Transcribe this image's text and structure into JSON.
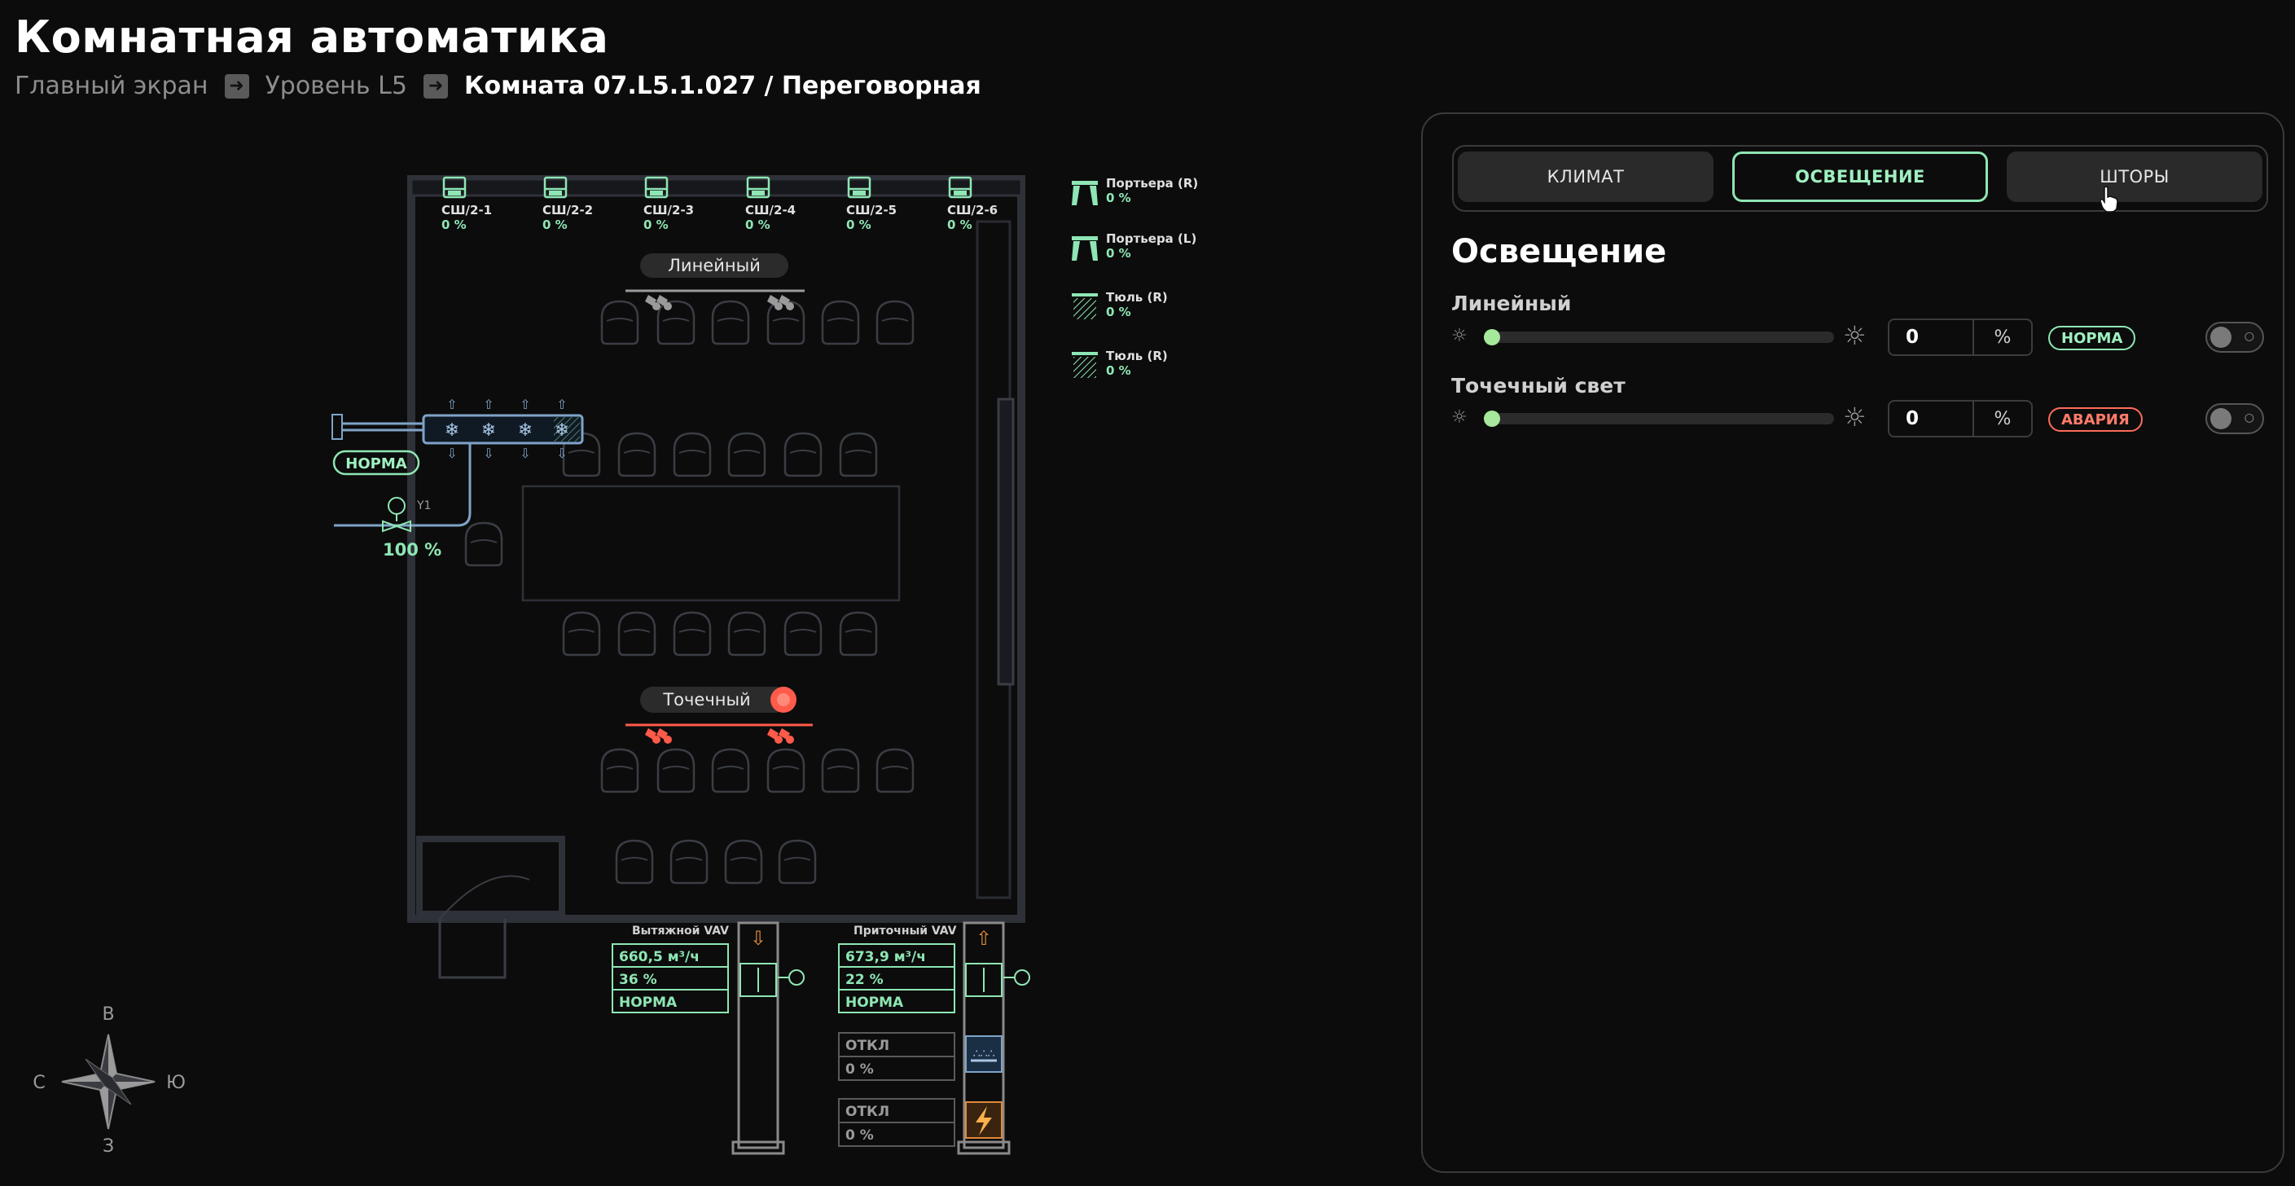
{
  "header": {
    "title": "Комнатная автоматика",
    "breadcrumbs": [
      "Главный экран",
      "Уровень L5",
      "Комната 07.L5.1.027 / Переговорная"
    ],
    "arrow_glyph": "➜"
  },
  "plan": {
    "windows": [
      {
        "name": "СШ/2-1",
        "value": "0 %"
      },
      {
        "name": "СШ/2-2",
        "value": "0 %"
      },
      {
        "name": "СШ/2-3",
        "value": "0 %"
      },
      {
        "name": "СШ/2-4",
        "value": "0 %"
      },
      {
        "name": "СШ/2-5",
        "value": "0 %"
      },
      {
        "name": "СШ/2-6",
        "value": "0 %"
      }
    ],
    "curtains": [
      {
        "name": "Портьера (R)",
        "value": "0 %",
        "icon": "curtain-icon"
      },
      {
        "name": "Портьера (L)",
        "value": "0 %",
        "icon": "curtain-icon"
      },
      {
        "name": "Тюль (R)",
        "value": "0 %",
        "icon": "tulle-icon"
      },
      {
        "name": "Тюль (R)",
        "value": "0 %",
        "icon": "tulle-icon"
      }
    ],
    "light_linear_label": "Линейный",
    "light_spot_label": "Точечный",
    "fancoil_status": "НОРМА",
    "valve_label": "Y1",
    "valve_value": "100 %",
    "compass": {
      "n": "В",
      "s": "З",
      "w": "С",
      "e": "Ю"
    },
    "exhaust_vav": {
      "title": "Вытяжной VAV",
      "flow": "660,5 м³/ч",
      "percent": "36 %",
      "status": "НОРМА"
    },
    "supply_vav": {
      "title": "Приточный VAV",
      "flow": "673,9 м³/ч",
      "percent": "22 %",
      "status": "НОРМА"
    },
    "heater": {
      "state": "ОТКЛ",
      "value": "0 %"
    },
    "electric": {
      "state": "ОТКЛ",
      "value": "0 %"
    },
    "colors": {
      "ok": "#8ee6b4",
      "alarm": "#ff5a4a",
      "duct": "#7fa3c8",
      "wall": "#2f3138"
    }
  },
  "panel": {
    "tabs": [
      "КЛИМАТ",
      "ОСВЕЩЕНИЕ",
      "ШТОРЫ"
    ],
    "active_tab": "ОСВЕЩЕНИЕ",
    "section_title": "Освещение",
    "rows": [
      {
        "label": "Линейный",
        "value": "0",
        "unit": "%",
        "status": "НОРМА",
        "level": 0
      },
      {
        "label": "Точечный свет",
        "value": "0",
        "unit": "%",
        "status": "АВАРИЯ",
        "level": 0
      }
    ]
  }
}
